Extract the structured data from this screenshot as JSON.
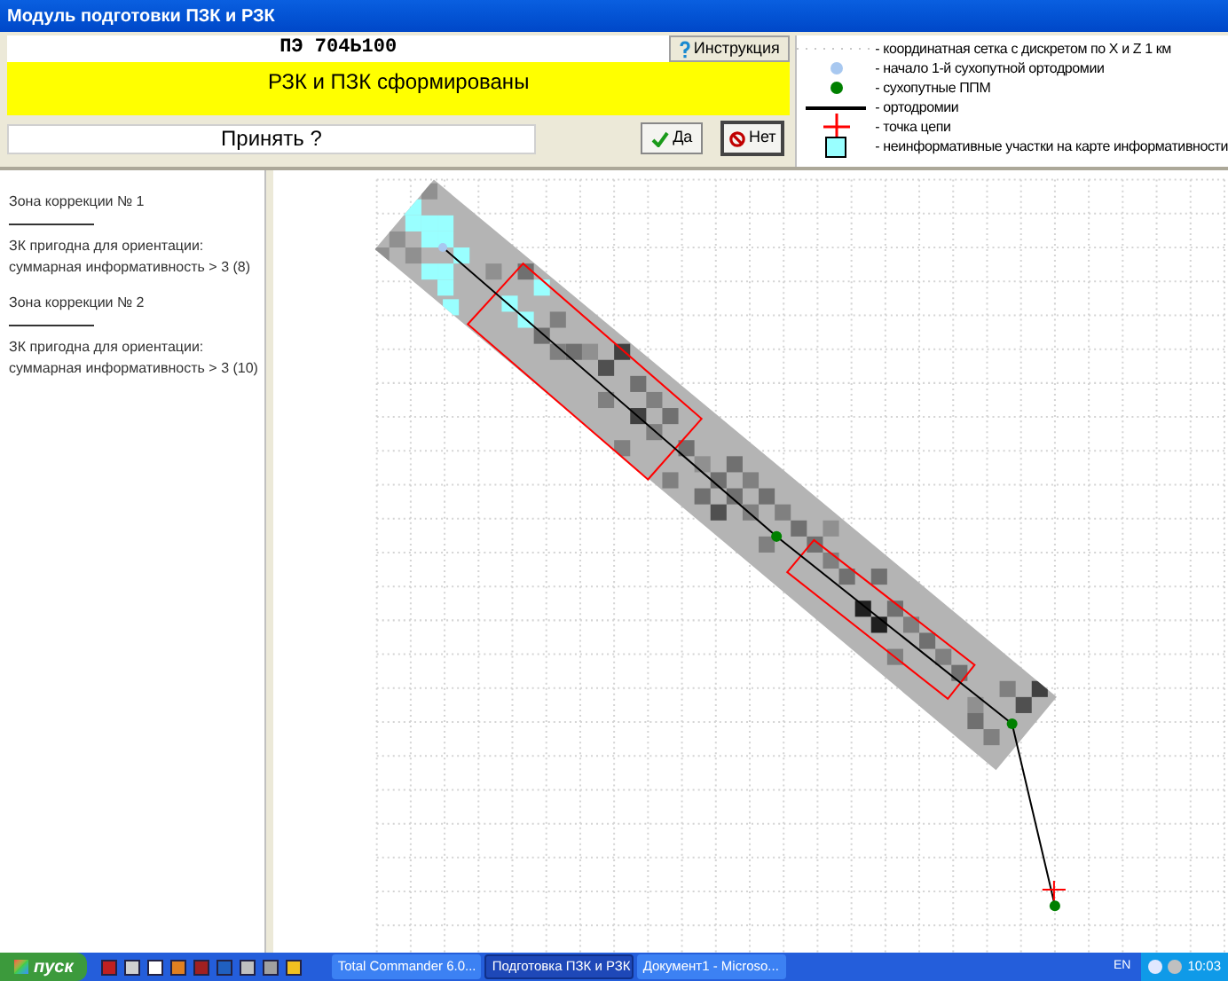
{
  "window": {
    "title": "Модуль подготовки ПЗК и РЗК"
  },
  "header": {
    "code": "ПЭ  704Ь100",
    "help_button": "Инструкция",
    "status": "РЗК и ПЗК сформированы",
    "prompt": "Принять ?",
    "yes_button": "Да",
    "no_button": "Нет"
  },
  "legend": [
    {
      "kind": "grid",
      "label": "- координатная сетка с дискретом  по X и Z  1 км"
    },
    {
      "kind": "dot",
      "color": "#a8c8f0",
      "label": "- начало 1-й сухопутной ортодромии"
    },
    {
      "kind": "dot",
      "color": "#008000",
      "label": "- сухопутные ППМ"
    },
    {
      "kind": "line",
      "label": "- ортодромии"
    },
    {
      "kind": "cross",
      "label": "- точка цепи"
    },
    {
      "kind": "square",
      "label": "- неинформативные участки на карте информативности"
    }
  ],
  "zones": [
    {
      "title": "Зона коррекции № 1",
      "lines": [
        "ЗК пригодна для ориентации:",
        "суммарная информативность > 3 (8)"
      ]
    },
    {
      "title": "Зона коррекции № 2",
      "lines": [
        "ЗК пригодна для ориентации:",
        "суммарная информативность > 3 (10)"
      ]
    }
  ],
  "taskbar": {
    "start": "пуск",
    "tasks": [
      {
        "label": "Total Commander 6.0...",
        "selected": false
      },
      {
        "label": "Подготовка ПЗК и РЗК",
        "selected": true
      },
      {
        "label": "Документ1 - Microso...",
        "selected": false
      }
    ],
    "language": "EN",
    "time": "10:03"
  }
}
